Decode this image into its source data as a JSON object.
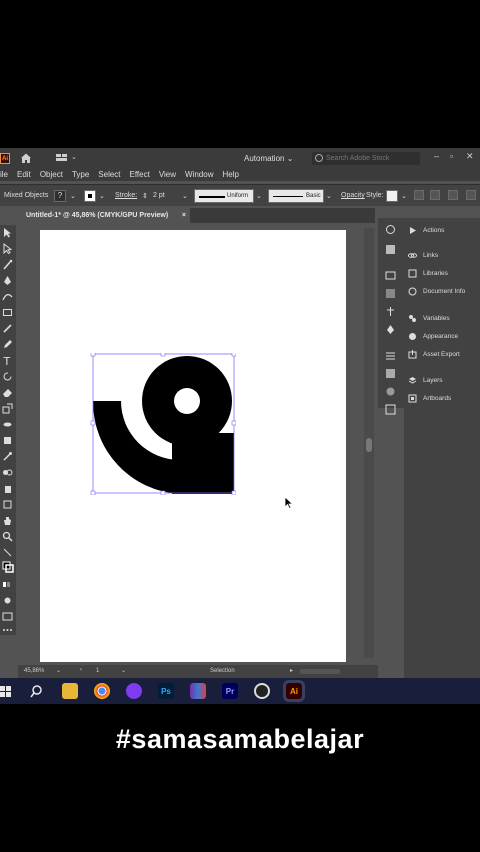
{
  "app": {
    "badge": "Ai",
    "menus": [
      "ile",
      "Edit",
      "Object",
      "Type",
      "Select",
      "Effect",
      "View",
      "Window",
      "Help"
    ],
    "workspace": "Automation",
    "search_placeholder": "Search Adobe Stock"
  },
  "control_bar": {
    "selection_label": "Mixed Objects",
    "stroke_label": "Stroke:",
    "stroke_value": "2 pt",
    "stroke_style": "Uniform",
    "brush": "Basic",
    "opacity_label": "Opacity",
    "style_label": "Style:"
  },
  "document": {
    "tab_label": "Untitled-1* @ 45,86% (CMYK/GPU Preview)",
    "close": "×"
  },
  "panels": [
    {
      "label": "Actions",
      "icon": "play-icon"
    },
    {
      "label": "Links",
      "icon": "links-icon"
    },
    {
      "label": "Libraries",
      "icon": "libraries-icon"
    },
    {
      "label": "Document Info",
      "icon": "document-info-icon"
    },
    {
      "label": "Variables",
      "icon": "variables-icon"
    },
    {
      "label": "Appearance",
      "icon": "appearance-icon"
    },
    {
      "label": "Asset Export",
      "icon": "asset-export-icon"
    },
    {
      "label": "Layers",
      "icon": "layers-icon"
    },
    {
      "label": "Artboards",
      "icon": "artboards-icon"
    }
  ],
  "status": {
    "zoom": "45,86%",
    "artboard_num": "1",
    "tool": "Selection"
  },
  "taskbar": {
    "apps": [
      "windows-start",
      "search",
      "file-explorer",
      "chrome",
      "tor",
      "Ps",
      "winrar",
      "Pr",
      "obs",
      "Ai"
    ]
  },
  "caption": "#samasamabelajar",
  "colors": {
    "app_bg": "#535353",
    "panel_bg": "#424242",
    "taskbar_bg": "#191f3a",
    "artwork": "#000000",
    "selection": "#7b6cff"
  }
}
